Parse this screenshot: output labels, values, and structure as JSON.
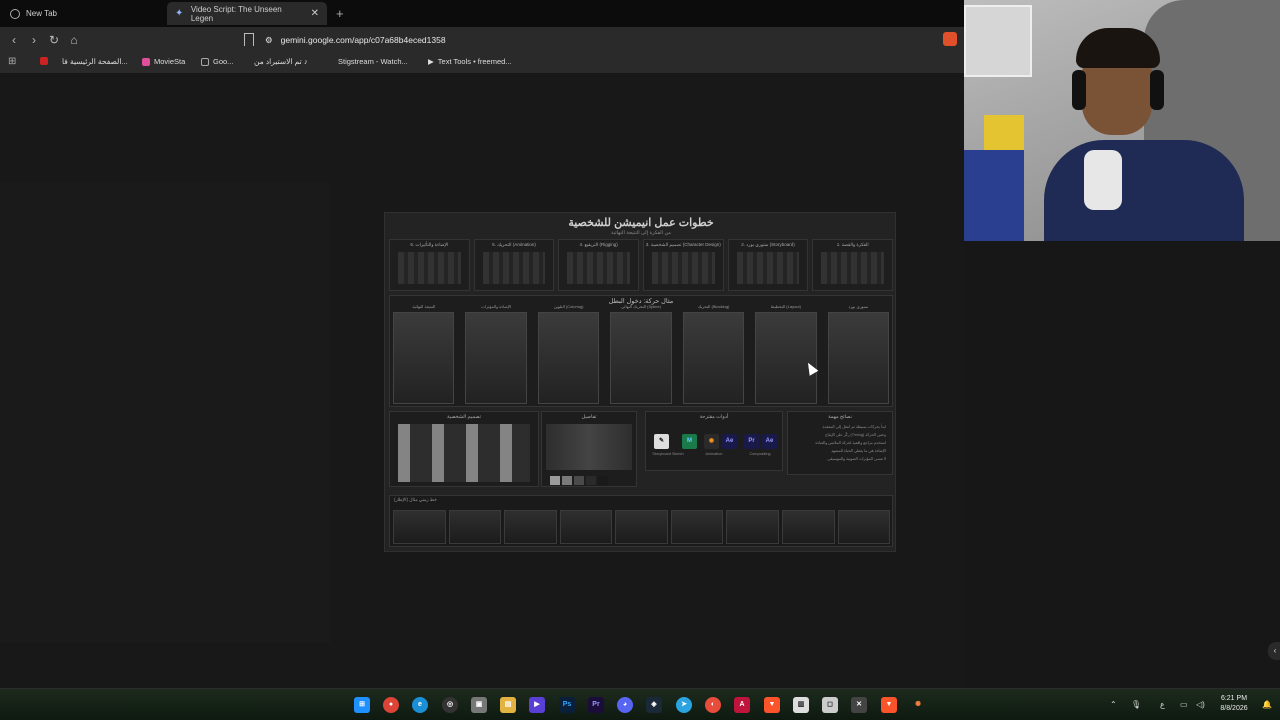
{
  "browser": {
    "tabs": [
      {
        "label": "New Tab"
      },
      {
        "label": "Video Script: The Unseen Legen"
      }
    ],
    "new_tab_symbol": "+",
    "url": "gemini.google.com/app/c07a68b4eced1358",
    "bookmarks": [
      {
        "label": "الصفحة الرئيسية فا..."
      },
      {
        "label": "MovieSta"
      },
      {
        "label": "Goo..."
      },
      {
        "label": "تم الاستيراد من"
      },
      {
        "label": "Stigstream - Watch..."
      },
      {
        "label": "Text Tools • freemed..."
      }
    ]
  },
  "poster": {
    "title": "خطوات عمل انيميشن للشخصية",
    "subtitle": "من الفكرة إلى النتيجة النهائية",
    "steps": [
      "1. الفكرة والقصة",
      "2. ستوري بورد (Storyboard)",
      "3. تصميم الشخصية (Character Design)",
      "4. التريقيع (Rigging)",
      "5. التحريك (Animation)",
      "6. الإضاءة والتأثيرات"
    ],
    "example_title": "مثال حركة: دخول البطل",
    "frames": [
      "ستوري بورد",
      "التخطيط (Layout)",
      "التحريك (Blocking)",
      "التحريك النهائي (Spline)",
      "التلوين (Coloring)",
      "الإضاءة والمؤثرات",
      "النتيجة النهائية"
    ],
    "char_design_title": "تصميم الشخصية",
    "details_title": "تفاصيل",
    "tools_title": "أدوات مقترحة",
    "tools": [
      "Storyboard Sketch",
      "Animation",
      "Compositing"
    ],
    "tips_title": "نصائح مهمة",
    "tips": [
      "ابدأ بحركات بسيطة ثم انتقل إلى المعقدة",
      "ركّز على الإيقاع (Timing) وحس الحركة",
      "استخدم مراجع واقعية لحركة الملابس والعباءة",
      "الإضاءة هي ما يعطي الحياة للمشهد",
      "لا تنسى المؤثرات الصوتية والموسيقى"
    ],
    "strip_title": "خط زمني مثال (الإطار)"
  },
  "taskbar": {
    "clock_time": "6:21 PM",
    "clock_date": "8/8/2026",
    "lang": "ع"
  },
  "colors": {
    "accent_brave": "#e0502a",
    "gemini_icon": "#8ab4f8"
  }
}
